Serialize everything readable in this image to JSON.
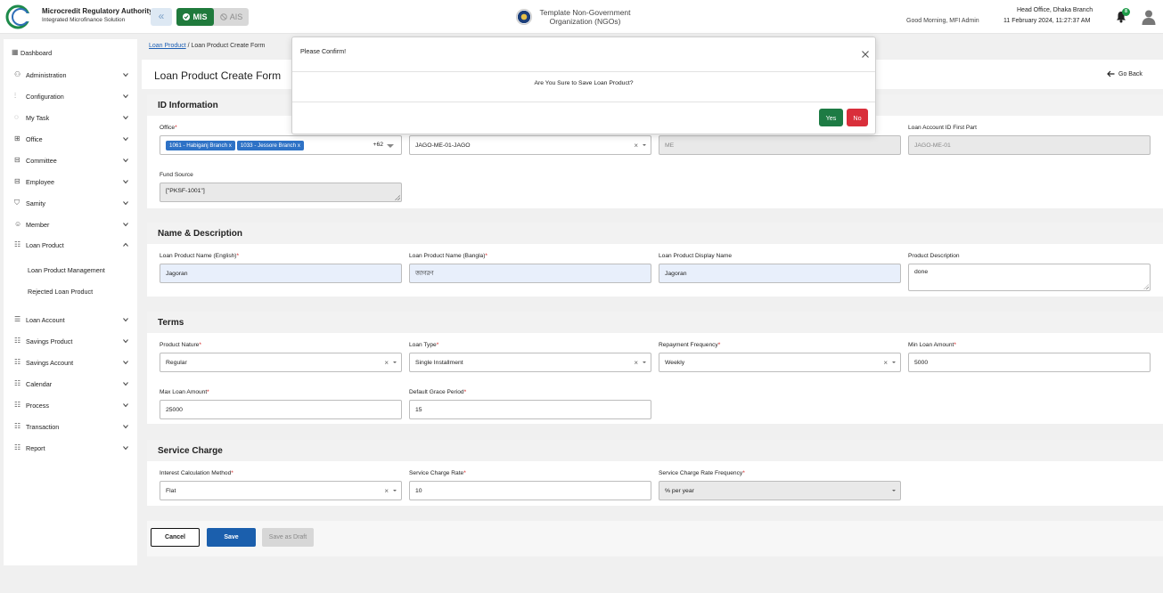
{
  "header": {
    "org_title": "Microcredit Regulatory Authority",
    "org_subtitle": "Integrated Microfinance Solution",
    "mode_active": "MIS",
    "mode_inactive": "AIS",
    "gov_title": "Template Non-Government Organization (NGOs)",
    "greeting": "Good Morning, MFI Admin",
    "branch": "Head Office, Dhaka Branch",
    "datetime": "11 February 2024, 11:27:37 AM",
    "notification_count": "8"
  },
  "sidebar": {
    "items": [
      {
        "label": "Dashboard",
        "icon": "dashboard-icon"
      },
      {
        "label": "Administration",
        "icon": "admin-icon"
      },
      {
        "label": "Configuration",
        "icon": "config-icon"
      },
      {
        "label": "My Task",
        "icon": "task-icon"
      },
      {
        "label": "Office",
        "icon": "office-icon"
      },
      {
        "label": "Committee",
        "icon": "committee-icon"
      },
      {
        "label": "Employee",
        "icon": "employee-icon"
      },
      {
        "label": "Samity",
        "icon": "samity-icon"
      },
      {
        "label": "Member",
        "icon": "member-icon"
      },
      {
        "label": "Loan Product",
        "icon": "loan-product-icon"
      },
      {
        "label": "Loan Account",
        "icon": "loan-account-icon"
      },
      {
        "label": "Savings Product",
        "icon": "savings-product-icon"
      },
      {
        "label": "Savings Account",
        "icon": "savings-account-icon"
      },
      {
        "label": "Calendar",
        "icon": "calendar-icon"
      },
      {
        "label": "Process",
        "icon": "process-icon"
      },
      {
        "label": "Transaction",
        "icon": "transaction-icon"
      },
      {
        "label": "Report",
        "icon": "report-icon"
      }
    ],
    "sub_items": [
      "Loan Product Management",
      "Rejected Loan Product"
    ]
  },
  "breadcrumb": {
    "link": "Loan Product",
    "separator": "/",
    "current": "Loan Product Create Form"
  },
  "page": {
    "title": "Loan Product Create Form",
    "go_back": "Go Back"
  },
  "id_info": {
    "title": "ID Information",
    "office_label": "Office",
    "office_chips": [
      "1061 - Habiganj Branch",
      "1033 - Jessore Branch"
    ],
    "office_more": "+62",
    "code_value": "JAGO-ME-01-JAGO",
    "me_value": "ME",
    "account_first_label": "Loan Account ID First Part",
    "account_first_value": "JAGO-ME-01",
    "fund_label": "Fund Source",
    "fund_value": "[\"PKSF-1001\"]"
  },
  "name_desc": {
    "title": "Name & Description",
    "en_label": "Loan Product Name (English)",
    "en_value": "Jagoran",
    "bn_label": "Loan Product Name (Bangla)",
    "bn_value": "জাগরণ",
    "display_label": "Loan Product Display Name",
    "display_value": "Jagoran",
    "desc_label": "Product Description",
    "desc_value": "done"
  },
  "terms": {
    "title": "Terms",
    "nature_label": "Product Nature",
    "nature_value": "Regular",
    "type_label": "Loan Type",
    "type_value": "Single Installment",
    "freq_label": "Repayment Frequency",
    "freq_value": "Weekly",
    "min_label": "Min Loan Amount",
    "min_value": "5000",
    "max_label": "Max Loan Amount",
    "max_value": "25000",
    "grace_label": "Default Grace Period",
    "grace_value": "15"
  },
  "service": {
    "title": "Service Charge",
    "method_label": "Interest Calculation Method",
    "method_value": "Flat",
    "rate_label": "Service Charge Rate",
    "rate_value": "10",
    "rate_freq_label": "Service Charge Rate Frequency",
    "rate_freq_value": "% per year"
  },
  "actions": {
    "cancel": "Cancel",
    "save": "Save",
    "draft": "Save as Draft"
  },
  "modal": {
    "title": "Please Confirm!",
    "message": "Are You Sure to Save Loan Product?",
    "yes": "Yes",
    "no": "No"
  },
  "colors": {
    "primary": "#1b5fad",
    "mis_green": "#1f7a3c",
    "yes_green": "#1d7b44",
    "no_red": "#d92f3b",
    "required": "#d21818"
  }
}
